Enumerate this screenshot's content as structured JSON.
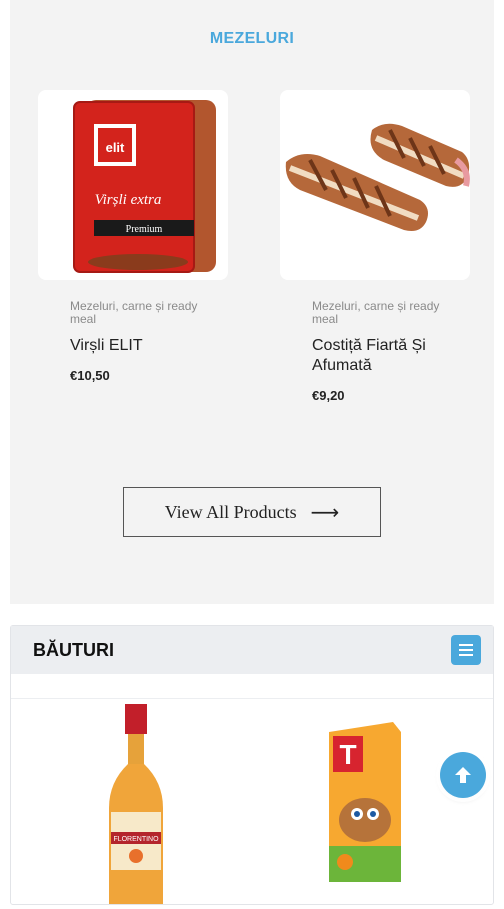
{
  "mezeluri": {
    "title": "MEZELURI",
    "products": [
      {
        "category": "Mezeluri, carne și ready meal",
        "name": "Virșli ELIT",
        "price": "€10,50",
        "image_icon": "sausage-pack-image"
      },
      {
        "category": "Mezeluri, carne și ready meal",
        "name": "Costiță Fiartă Și Afumată",
        "price": "€9,20",
        "image_icon": "smoked-ribs-image"
      }
    ],
    "view_all_label": "View All Products",
    "view_all_icon": "arrow-right-icon"
  },
  "bauturi": {
    "title": "BĂUTURI",
    "menu_icon": "hamburger-menu-icon"
  },
  "scroll_top_icon": "arrow-up-icon",
  "colors": {
    "accent": "#4aa8dc",
    "section_bg": "#f3f3f3",
    "header_bg": "#eceef1"
  }
}
